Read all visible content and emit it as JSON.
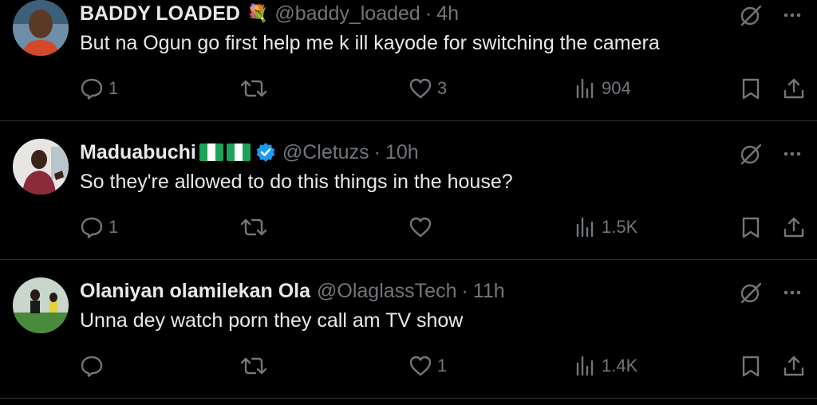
{
  "tweets": [
    {
      "name": "BADDY LOADED",
      "emoji": "💐",
      "handle": "@baddy_loaded",
      "dot": "·",
      "time": "4h",
      "text": "But na Ogun go first help me k ill kayode for switching the camera",
      "replies": "1",
      "retweets": "",
      "likes": "3",
      "views": "904"
    },
    {
      "name": "Maduabuchi",
      "handle": "@Cletuzs",
      "dot": "·",
      "time": "10h",
      "text": "So they're allowed to do this things in the house?",
      "replies": "1",
      "retweets": "",
      "likes": "",
      "views": "1.5K",
      "verified": true
    },
    {
      "name": "Olaniyan olamilekan Ola",
      "handle": "@OlaglassTech",
      "dot": "·",
      "time": "11h",
      "text": "Unna dey watch porn they call am TV show",
      "replies": "",
      "retweets": "",
      "likes": "1",
      "views": "1.4K"
    }
  ],
  "colors": {
    "background": "#000000",
    "muted": "#71767b",
    "text": "#e7e9ea",
    "verified": "#1d9bf0",
    "divider": "#2f3336"
  }
}
